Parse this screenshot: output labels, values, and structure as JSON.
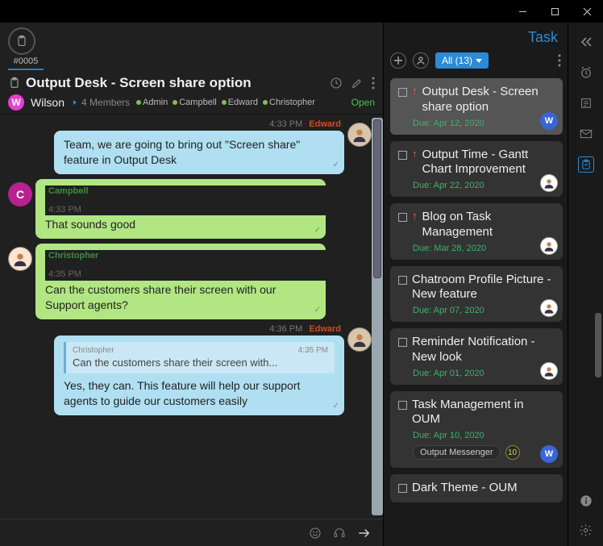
{
  "window": {
    "tab_id": "#0005",
    "title": "Output Desk - Screen share option",
    "creator_initial": "W",
    "creator_name": "Wilson",
    "members_count": "4 Members",
    "members": [
      "Admin",
      "Campbell",
      "Edward",
      "Christopher"
    ],
    "status": "Open"
  },
  "messages": [
    {
      "side": "right",
      "author": "Edward",
      "time": "4:33 PM",
      "text": "Team, we are going to bring out \"Screen share\" feature in Output Desk",
      "color": "blue",
      "avatar": "img1"
    },
    {
      "side": "left",
      "author": "Campbell",
      "time": "4:33 PM",
      "text": "That sounds good",
      "color": "green",
      "avatar": "img2"
    },
    {
      "side": "left",
      "author": "Christopher",
      "time": "4:35 PM",
      "text": "Can the customers share their screen with our Support agents?",
      "color": "green",
      "avatar": "img3"
    },
    {
      "side": "right",
      "author": "Edward",
      "time": "4:36 PM",
      "quote": {
        "author": "Christopher",
        "time": "4:35 PM",
        "text": "Can the customers share their screen with..."
      },
      "text": "Yes, they can. This feature will help our support agents to guide our customers easily",
      "color": "blue",
      "avatar": "img1"
    }
  ],
  "task_panel": {
    "title": "Task",
    "filter_label": "All (13)"
  },
  "tasks": [
    {
      "title": "Output Desk - Screen share option",
      "due": "Due: Apr 12, 2020",
      "priority": true,
      "avatar": "W",
      "selected": true
    },
    {
      "title": "Output Time - Gantt Chart Improvement",
      "due": "Due: Apr 22, 2020",
      "priority": true,
      "avatar": "p"
    },
    {
      "title": "Blog on Task Management",
      "due": "Due: Mar 28, 2020",
      "priority": true,
      "avatar": "p"
    },
    {
      "title": "Chatroom Profile Picture - New feature",
      "due": "Due: Apr 07, 2020",
      "priority": false,
      "avatar": "p"
    },
    {
      "title": "Reminder Notification - New look",
      "due": "Due: Apr 01, 2020",
      "priority": false,
      "avatar": "p"
    },
    {
      "title": "Task Management in OUM",
      "due": "Due: Apr 10, 2020",
      "priority": false,
      "avatar": "W",
      "chip": "Output Messenger",
      "chip_count": "10"
    },
    {
      "title": "Dark Theme - OUM",
      "due": "",
      "priority": false,
      "avatar": ""
    }
  ]
}
